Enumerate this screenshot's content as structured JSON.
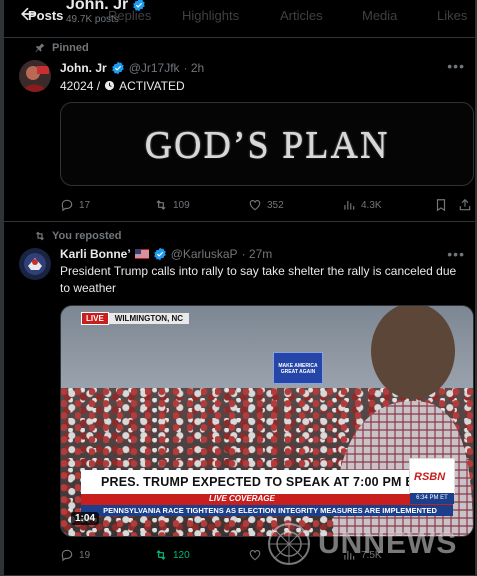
{
  "header": {
    "name": "John. Jr",
    "posts_count": "49.7K posts",
    "tabs": [
      "Posts",
      "Replies",
      "Highlights",
      "Articles",
      "Media",
      "Likes"
    ]
  },
  "tweet1": {
    "context": "Pinned",
    "display_name": "John. Jr",
    "handle": "@Jr17Jfk",
    "time": "· 2h",
    "text_prefix": "42024 /",
    "text_suffix": "ACTIVATED",
    "card_text": "GOD’S PLAN",
    "replies": "17",
    "reposts": "109",
    "likes": "352",
    "views": "4.3K"
  },
  "tweet2": {
    "context": "You reposted",
    "display_name": "Karli Bonne’",
    "handle": "@KarluskaP",
    "time": "· 27m",
    "text": "President Trump calls into rally to say take shelter the rally is canceled due to weather",
    "video": {
      "live_label": "LIVE",
      "location": "WILMINGTON, NC",
      "stage_sign": "MAKE AMERICA GREAT AGAIN",
      "lower_third": "PRES. TRUMP EXPECTED TO SPEAK AT 7:00 PM ET",
      "live_coverage": "LIVE COVERAGE",
      "ticker": "PENNSYLVANIA RACE TIGHTENS AS ELECTION INTEGRITY MEASURES ARE IMPLEMENTED",
      "network": "RSBN",
      "network_time": "6:34 PM ET",
      "duration": "1:04"
    },
    "replies": "19",
    "reposts": "120",
    "likes": "",
    "views": "7.5K"
  },
  "watermark": "UNNEWS",
  "colors": {
    "accent": "#1d9bf0",
    "repost_active": "#00ba7c",
    "muted": "#71767b",
    "border": "#2f3336"
  }
}
